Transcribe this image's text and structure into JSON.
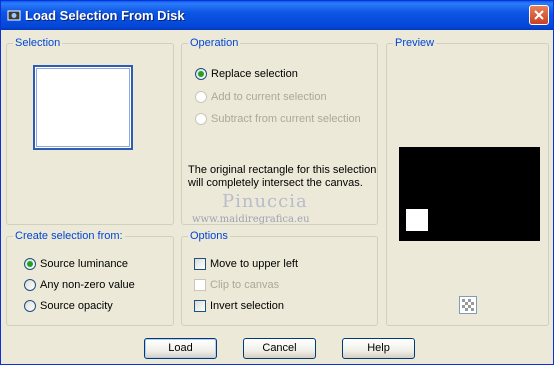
{
  "window": {
    "title": "Load Selection From Disk",
    "icon": "psp-app-icon"
  },
  "selection": {
    "legend": "Selection"
  },
  "operation": {
    "legend": "Operation",
    "options": [
      {
        "label": "Replace selection",
        "checked": true,
        "enabled": true
      },
      {
        "label": "Add to current selection",
        "checked": false,
        "enabled": false
      },
      {
        "label": "Subtract from current selection",
        "checked": false,
        "enabled": false
      }
    ],
    "info": "The original rectangle for this selection will completely intersect the canvas."
  },
  "preview": {
    "legend": "Preview"
  },
  "create_from": {
    "legend": "Create selection from:",
    "options": [
      {
        "label": "Source luminance",
        "checked": true
      },
      {
        "label": "Any non-zero value",
        "checked": false
      },
      {
        "label": "Source opacity",
        "checked": false
      }
    ]
  },
  "options": {
    "legend": "Options",
    "items": [
      {
        "label": "Move to upper left",
        "checked": false,
        "enabled": true
      },
      {
        "label": "Clip to canvas",
        "checked": false,
        "enabled": false
      },
      {
        "label": "Invert selection",
        "checked": false,
        "enabled": true
      }
    ]
  },
  "watermark": {
    "name": "Pinuccia",
    "url": "www.maidiregrafica.eu"
  },
  "buttons": {
    "load": "Load",
    "cancel": "Cancel",
    "help": "Help"
  },
  "colors": {
    "title_bar": "#0a5bf0",
    "group_label": "#0046d5",
    "dialog_bg": "#ece9d8"
  }
}
